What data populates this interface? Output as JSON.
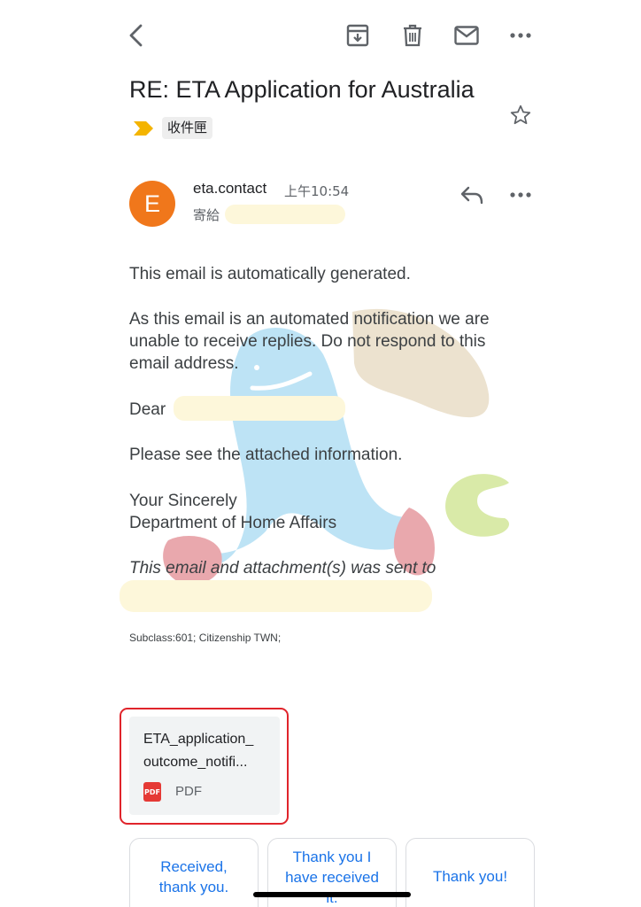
{
  "toolbar": {
    "back_icon": "back-arrow-icon",
    "archive_icon": "archive-icon",
    "delete_icon": "trash-icon",
    "mark_unread_icon": "mail-icon",
    "more_icon": "more-horizontal-icon"
  },
  "email": {
    "subject": "RE: ETA Application for Australia",
    "label": "收件匣",
    "label_color": "#f4b400",
    "star_icon": "star-outline-icon",
    "sender": {
      "avatar_letter": "E",
      "avatar_color": "#f0771b",
      "name": "eta.contact",
      "time": "上午10:54",
      "to_prefix": "寄給"
    },
    "body": {
      "line1": "This email is automatically generated.",
      "para2_l1": "As this email is an automated notification we are",
      "para2_l2": "unable to receive replies. Do not respond to this",
      "para2_l3": "email address.",
      "dear": "Dear",
      "attached": "Please see the attached information.",
      "sign1": "Your Sincerely",
      "sign2": "Department of Home Affairs",
      "sent_to": "This email and attachment(s) was sent to",
      "subclass": "Subclass:601; Citizenship TWN;"
    },
    "attachment": {
      "name_line1": "ETA_application_",
      "name_line2": "outcome_notifi...",
      "type_badge": "PDF",
      "type_label": "PDF"
    }
  },
  "smart_replies": [
    {
      "line1": "Received,",
      "line2": "thank you."
    },
    {
      "line1": "Thank you I",
      "line2": "have received",
      "line3": "it."
    },
    {
      "line1": "Thank you!"
    }
  ],
  "colors": {
    "accent_blue": "#1a73e8",
    "highlight_red": "#e0242b"
  }
}
